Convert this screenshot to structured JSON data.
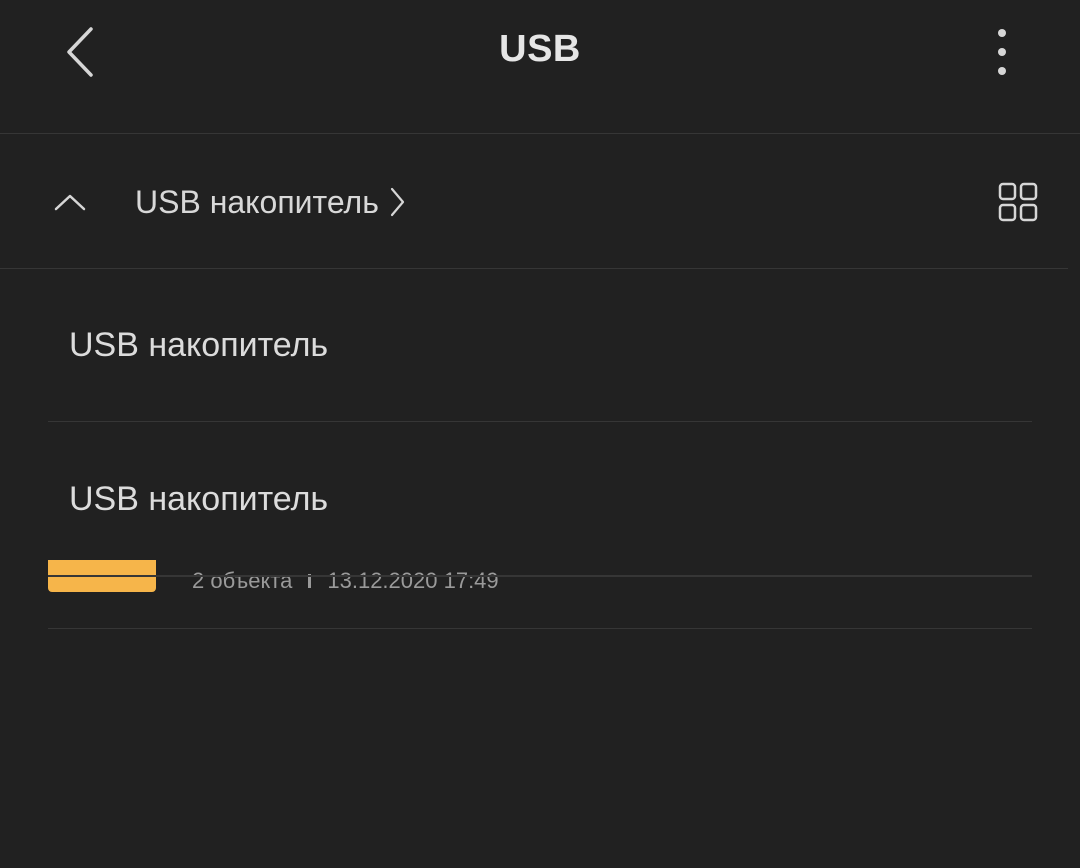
{
  "header": {
    "title": "USB",
    "back_icon": "chevron-left-icon",
    "more_icon": "more-vertical-icon"
  },
  "path_bar": {
    "collapse_icon": "chevron-up-icon",
    "crumb_label": "USB накопитель",
    "crumb_icon": "chevron-right-icon",
    "view_icon": "grid-view-icon"
  },
  "storage_menu": {
    "items": [
      {
        "label": "USB накопитель"
      },
      {
        "label": "USB накопитель"
      }
    ]
  },
  "file_list": {
    "rows": [
      {
        "icon": "folder-icon",
        "count": "2 объекта",
        "date": "13.12.2020 17:49"
      }
    ]
  },
  "colors": {
    "background": "#212121",
    "text": "#e0e0e0",
    "secondary_text": "#9a9a9a",
    "divider": "#363636",
    "folder": "#f6b54a"
  }
}
